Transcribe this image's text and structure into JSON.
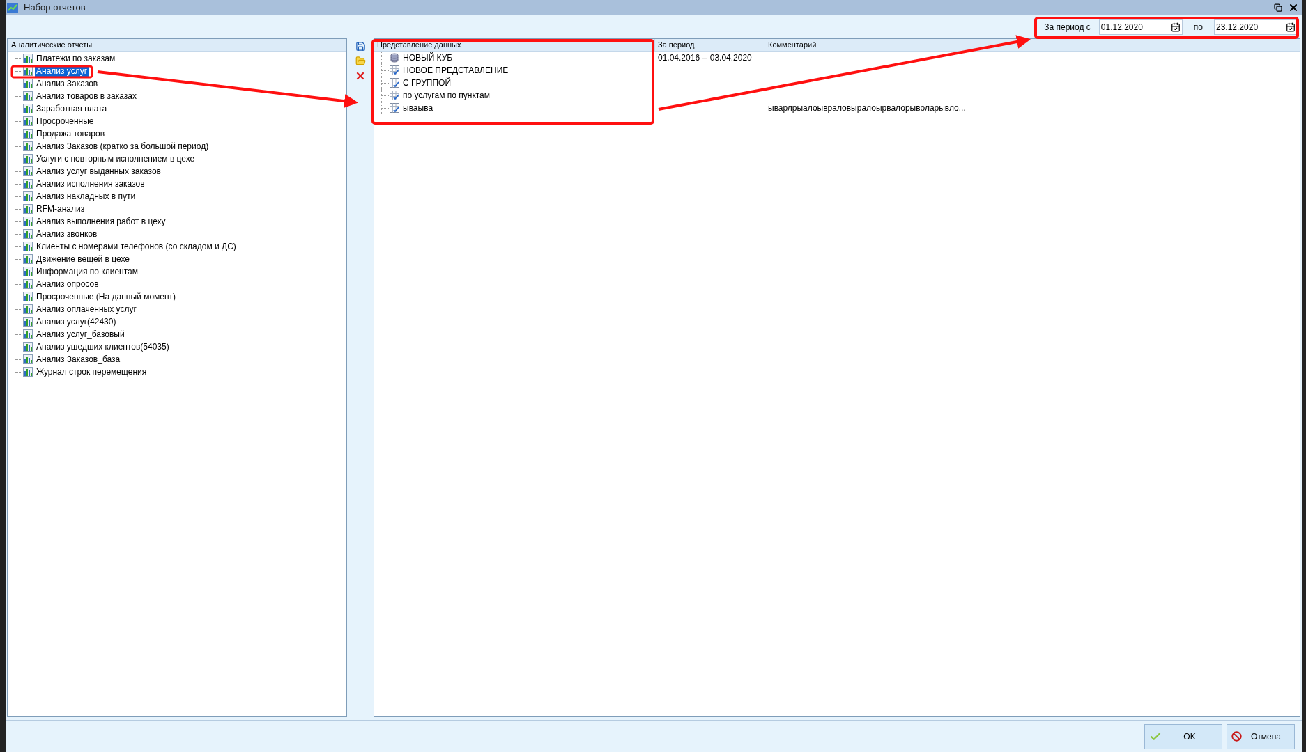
{
  "window": {
    "title": "Набор отчетов"
  },
  "period": {
    "from_label": "За период с",
    "from": "01.12.2020",
    "to_label": "по",
    "to": "23.12.2020"
  },
  "reports": {
    "header": "Аналитические отчеты",
    "items": [
      {
        "label": "Платежи по заказам",
        "selected": false
      },
      {
        "label": "Анализ услуг",
        "selected": true
      },
      {
        "label": "Анализ Заказов",
        "selected": false
      },
      {
        "label": "Анализ товаров в заказах",
        "selected": false
      },
      {
        "label": "Заработная плата",
        "selected": false
      },
      {
        "label": "Просроченные",
        "selected": false
      },
      {
        "label": "Продажа товаров",
        "selected": false
      },
      {
        "label": "Анализ Заказов (кратко за большой период)",
        "selected": false
      },
      {
        "label": "Услуги с повторным исполнением в цехе",
        "selected": false
      },
      {
        "label": "Анализ услуг выданных заказов",
        "selected": false
      },
      {
        "label": "Анализ исполнения заказов",
        "selected": false
      },
      {
        "label": "Анализ накладных в пути",
        "selected": false
      },
      {
        "label": "RFM-анализ",
        "selected": false
      },
      {
        "label": "Анализ выполнения работ в цеху",
        "selected": false
      },
      {
        "label": "Анализ звонков",
        "selected": false
      },
      {
        "label": "Клиенты с номерами телефонов (со складом и ДС)",
        "selected": false
      },
      {
        "label": "Движение вещей в цехе",
        "selected": false
      },
      {
        "label": "Информация по клиентам",
        "selected": false
      },
      {
        "label": "Анализ опросов",
        "selected": false
      },
      {
        "label": "Просроченные (На данный момент)",
        "selected": false
      },
      {
        "label": "Анализ оплаченных услуг",
        "selected": false
      },
      {
        "label": "Анализ услуг(42430)",
        "selected": false
      },
      {
        "label": "Анализ услуг_базовый",
        "selected": false
      },
      {
        "label": "Анализ ушедших клиентов(54035)",
        "selected": false
      },
      {
        "label": "Анализ Заказов_база",
        "selected": false
      },
      {
        "label": "Журнал строк перемещения",
        "selected": false
      }
    ]
  },
  "views": {
    "columns": [
      "Представление данных",
      "За период",
      "Комментарий"
    ],
    "rows": [
      {
        "kind": "cube",
        "name": "НОВЫЙ КУБ",
        "period": "01.04.2016 -- 03.04.2020"
      },
      {
        "kind": "view",
        "name": "НОВОЕ ПРЕДСТАВЛЕНИЕ"
      },
      {
        "kind": "view",
        "name": "С ГРУППОЙ"
      },
      {
        "kind": "view",
        "name": "по услугам по пунктам"
      },
      {
        "kind": "view",
        "name": "ываыва",
        "comment": "ыварлрыалоывраловыралоырвалорыволарывло..."
      }
    ]
  },
  "buttons": [
    {
      "kind": "ok",
      "label": "OK"
    },
    {
      "kind": "cancel",
      "label": "Отмена"
    }
  ]
}
